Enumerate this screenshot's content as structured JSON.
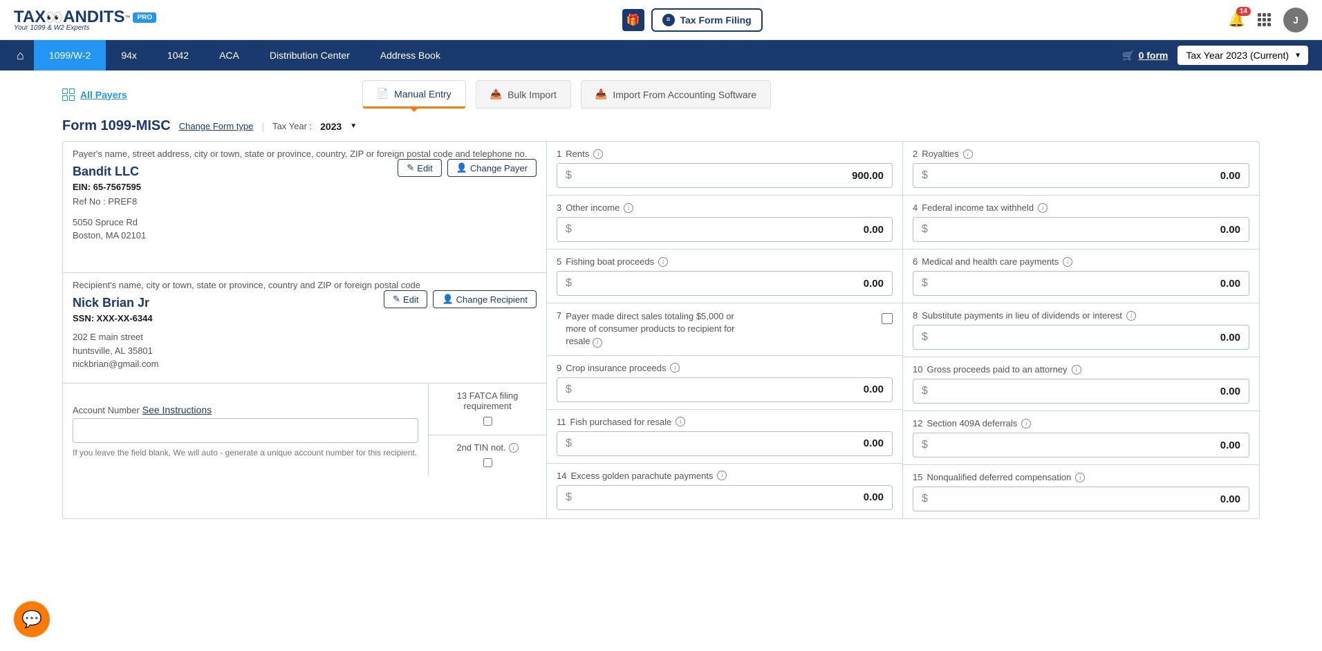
{
  "header": {
    "logo": {
      "main": "TAX",
      "suffix": "ANDITS",
      "sub": "Your 1099 & W2 Experts",
      "pro": "PRO",
      "tm": "™"
    },
    "tax_form_btn": "Tax Form Filing",
    "notif_count": "14",
    "avatar": "J"
  },
  "nav": {
    "tabs": [
      "1099/W-2",
      "94x",
      "1042",
      "ACA",
      "Distribution Center",
      "Address Book"
    ],
    "cart_label": "0 form",
    "tax_year": "Tax Year 2023 (Current)"
  },
  "subrow": {
    "all_payers": "All Payers",
    "tabs": [
      "Manual Entry",
      "Bulk Import",
      "Import From Accounting Software"
    ]
  },
  "form": {
    "title": "Form 1099-MISC",
    "change_type": "Change Form type",
    "tax_year_label": "Tax Year :",
    "tax_year_value": "2023"
  },
  "payer": {
    "section_label": "Payer's name, street address, city or town, state or province, country, ZIP or foreign postal code and telephone no.",
    "name": "Bandit LLC",
    "ein": "EIN: 65-7567595",
    "ref": "Ref No : PREF8",
    "addr1": "5050 Spruce Rd",
    "addr2": "Boston, MA 02101",
    "edit": "Edit",
    "change": "Change Payer"
  },
  "recipient": {
    "section_label": "Recipient's name, city or town, state or province, country and ZIP or foreign postal code",
    "name": "Nick Brian Jr",
    "ssn": "SSN: XXX-XX-6344",
    "addr1": "202 E main street",
    "addr2": "huntsville, AL 35801",
    "email": "nickbrian@gmail.com",
    "edit": "Edit",
    "change": "Change Recipient"
  },
  "account": {
    "label": "Account Number",
    "see": "See Instructions",
    "hint": "If you leave the field blank, We will auto - generate a unique account number for this recipient.",
    "fatca": "13 FATCA filing requirement",
    "tin": "2nd TIN not."
  },
  "boxes": {
    "b1": {
      "num": "1",
      "label": "Rents",
      "value": "900.00"
    },
    "b2": {
      "num": "2",
      "label": "Royalties",
      "value": "0.00"
    },
    "b3": {
      "num": "3",
      "label": "Other income",
      "value": "0.00"
    },
    "b4": {
      "num": "4",
      "label": "Federal income tax withheld",
      "value": "0.00"
    },
    "b5": {
      "num": "5",
      "label": "Fishing boat proceeds",
      "value": "0.00"
    },
    "b6": {
      "num": "6",
      "label": "Medical and health care payments",
      "value": "0.00"
    },
    "b7": {
      "num": "7",
      "label": "Payer made direct sales totaling $5,000 or more of consumer products to recipient for resale"
    },
    "b8": {
      "num": "8",
      "label": "Substitute payments in lieu of dividends or interest",
      "value": "0.00"
    },
    "b9": {
      "num": "9",
      "label": "Crop insurance proceeds",
      "value": "0.00"
    },
    "b10": {
      "num": "10",
      "label": "Gross proceeds paid to an attorney",
      "value": "0.00"
    },
    "b11": {
      "num": "11",
      "label": "Fish purchased for resale",
      "value": "0.00"
    },
    "b12": {
      "num": "12",
      "label": "Section 409A deferrals",
      "value": "0.00"
    },
    "b14": {
      "num": "14",
      "label": "Excess golden parachute payments",
      "value": "0.00"
    },
    "b15": {
      "num": "15",
      "label": "Nonqualified deferred compensation",
      "value": "0.00"
    }
  }
}
